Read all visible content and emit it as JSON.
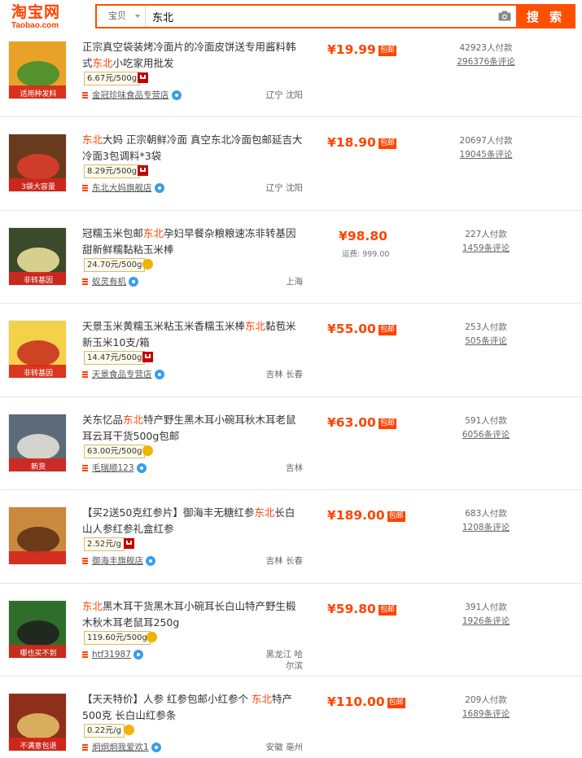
{
  "header": {
    "logo_cn": "淘宝网",
    "logo_en": "Taobao.com",
    "search_type": "宝贝",
    "search_query": "东北",
    "search_button": "搜 索",
    "brand_color": "#ff5000"
  },
  "products": [
    {
      "title_pre": "正宗真空袋装烤冷面片的冷面皮饼送专用酱料韩式",
      "title_hl": "东北",
      "title_post": "小吃家用批发",
      "unit_price": "6.67元/500g",
      "badge": "tmall-icon",
      "shop": "金冠珍味食品专营店",
      "location": "辽宁 沈阳",
      "price": "¥19.99",
      "baoyou": "包邮",
      "freight": "",
      "sales": "42923人付款",
      "comments": "296376条评论"
    },
    {
      "title_pre": "",
      "title_hl": "东北",
      "title_post": "大妈 正宗朝鲜冷面 真空东北冷面包邮延吉大冷面3包调料*3袋",
      "unit_price": "8.29元/500g",
      "badge": "tmall-icon",
      "shop": "东北大妈旗舰店",
      "location": "辽宁 沈阳",
      "price": "¥18.90",
      "baoyou": "包邮",
      "freight": "",
      "sales": "20697人付款",
      "comments": "19045条评论"
    },
    {
      "title_pre": "冠糯玉米包邮",
      "title_hl": "东北",
      "title_post": "孕妇早餐杂粮粮速冻非转基因甜新鲜糯黏粘玉米棒",
      "unit_price": "24.70元/500g",
      "badge": "gold-crown-icon",
      "shop": "蚁灵有机",
      "location": "上海",
      "price": "¥98.80",
      "baoyou": "",
      "freight": "运费: 999.00",
      "sales": "227人付款",
      "comments": "1459条评论"
    },
    {
      "title_pre": "天景玉米黄糯玉米粘玉米香糯玉米棒",
      "title_hl": "东北",
      "title_post": "黏苞米新玉米10支/箱",
      "unit_price": "14.47元/500g",
      "badge": "tmall-icon",
      "shop": "天景食品专营店",
      "location": "吉林 长春",
      "price": "¥55.00",
      "baoyou": "包邮",
      "freight": "",
      "sales": "253人付款",
      "comments": "505条评论"
    },
    {
      "title_pre": "关东忆品",
      "title_hl": "东北",
      "title_post": "特产野生黑木耳小碗耳秋木耳老鼠耳云耳干货500g包邮",
      "unit_price": "63.00元/500g",
      "badge": "gold-crown-icon",
      "shop": "毛瑞顺123",
      "location": "吉林",
      "price": "¥63.00",
      "baoyou": "包邮",
      "freight": "",
      "sales": "591人付款",
      "comments": "6056条评论"
    },
    {
      "title_pre": "【买2送50克红参片】御海丰无糖红参",
      "title_hl": "东北",
      "title_post": "长白山人参红参礼盒红参",
      "unit_price": "2.52元/g",
      "badge": "tmall-icon",
      "shop": "御海丰旗舰店",
      "location": "吉林 长春",
      "price": "¥189.00",
      "baoyou": "包邮",
      "freight": "",
      "sales": "683人付款",
      "comments": "1208条评论"
    },
    {
      "title_pre": "",
      "title_hl": "东北",
      "title_post": "黑木耳干货黑木耳小碗耳长白山特产野生椴木秋木耳老鼠耳250g",
      "unit_price": "119.60元/500g",
      "badge": "gold-crown-icon",
      "shop": "htf31987",
      "location": "黑龙江 哈尔滨",
      "price": "¥59.80",
      "baoyou": "包邮",
      "freight": "",
      "sales": "391人付款",
      "comments": "1926条评论"
    },
    {
      "title_pre": "【天天特价】人参 红参包邮小红参个 ",
      "title_hl": "东北",
      "title_post": "特产500克 长白山红参条",
      "unit_price": "0.22元/g",
      "badge": "gold-crown-icon",
      "shop": "炯炯炯我爱欢1",
      "location": "安徽 亳州",
      "price": "¥110.00",
      "baoyou": "包邮",
      "freight": "",
      "sales": "209人付款",
      "comments": "1689条评论"
    }
  ],
  "thumbnails": [
    {
      "bg": "#e8a22a",
      "accent": "#3a8f2e",
      "caption": "适用种发料"
    },
    {
      "bg": "#6a3a1e",
      "accent": "#e03e2d",
      "caption": "3袋大容量"
    },
    {
      "bg": "#3c4a2c",
      "accent": "#f2e6a0",
      "caption": "非转基因"
    },
    {
      "bg": "#f3d24a",
      "accent": "#c62b1f",
      "caption": "非转基因"
    },
    {
      "bg": "#5c6b78",
      "accent": "#e9e4da",
      "caption": "新货"
    },
    {
      "bg": "#c98a3e",
      "accent": "#5a2d12",
      "caption": ""
    },
    {
      "bg": "#2f6e2a",
      "accent": "#1d1d1d",
      "caption": "哪也买不到"
    },
    {
      "bg": "#8e2f1c",
      "accent": "#e6c36a",
      "caption": "不满意包退"
    }
  ]
}
